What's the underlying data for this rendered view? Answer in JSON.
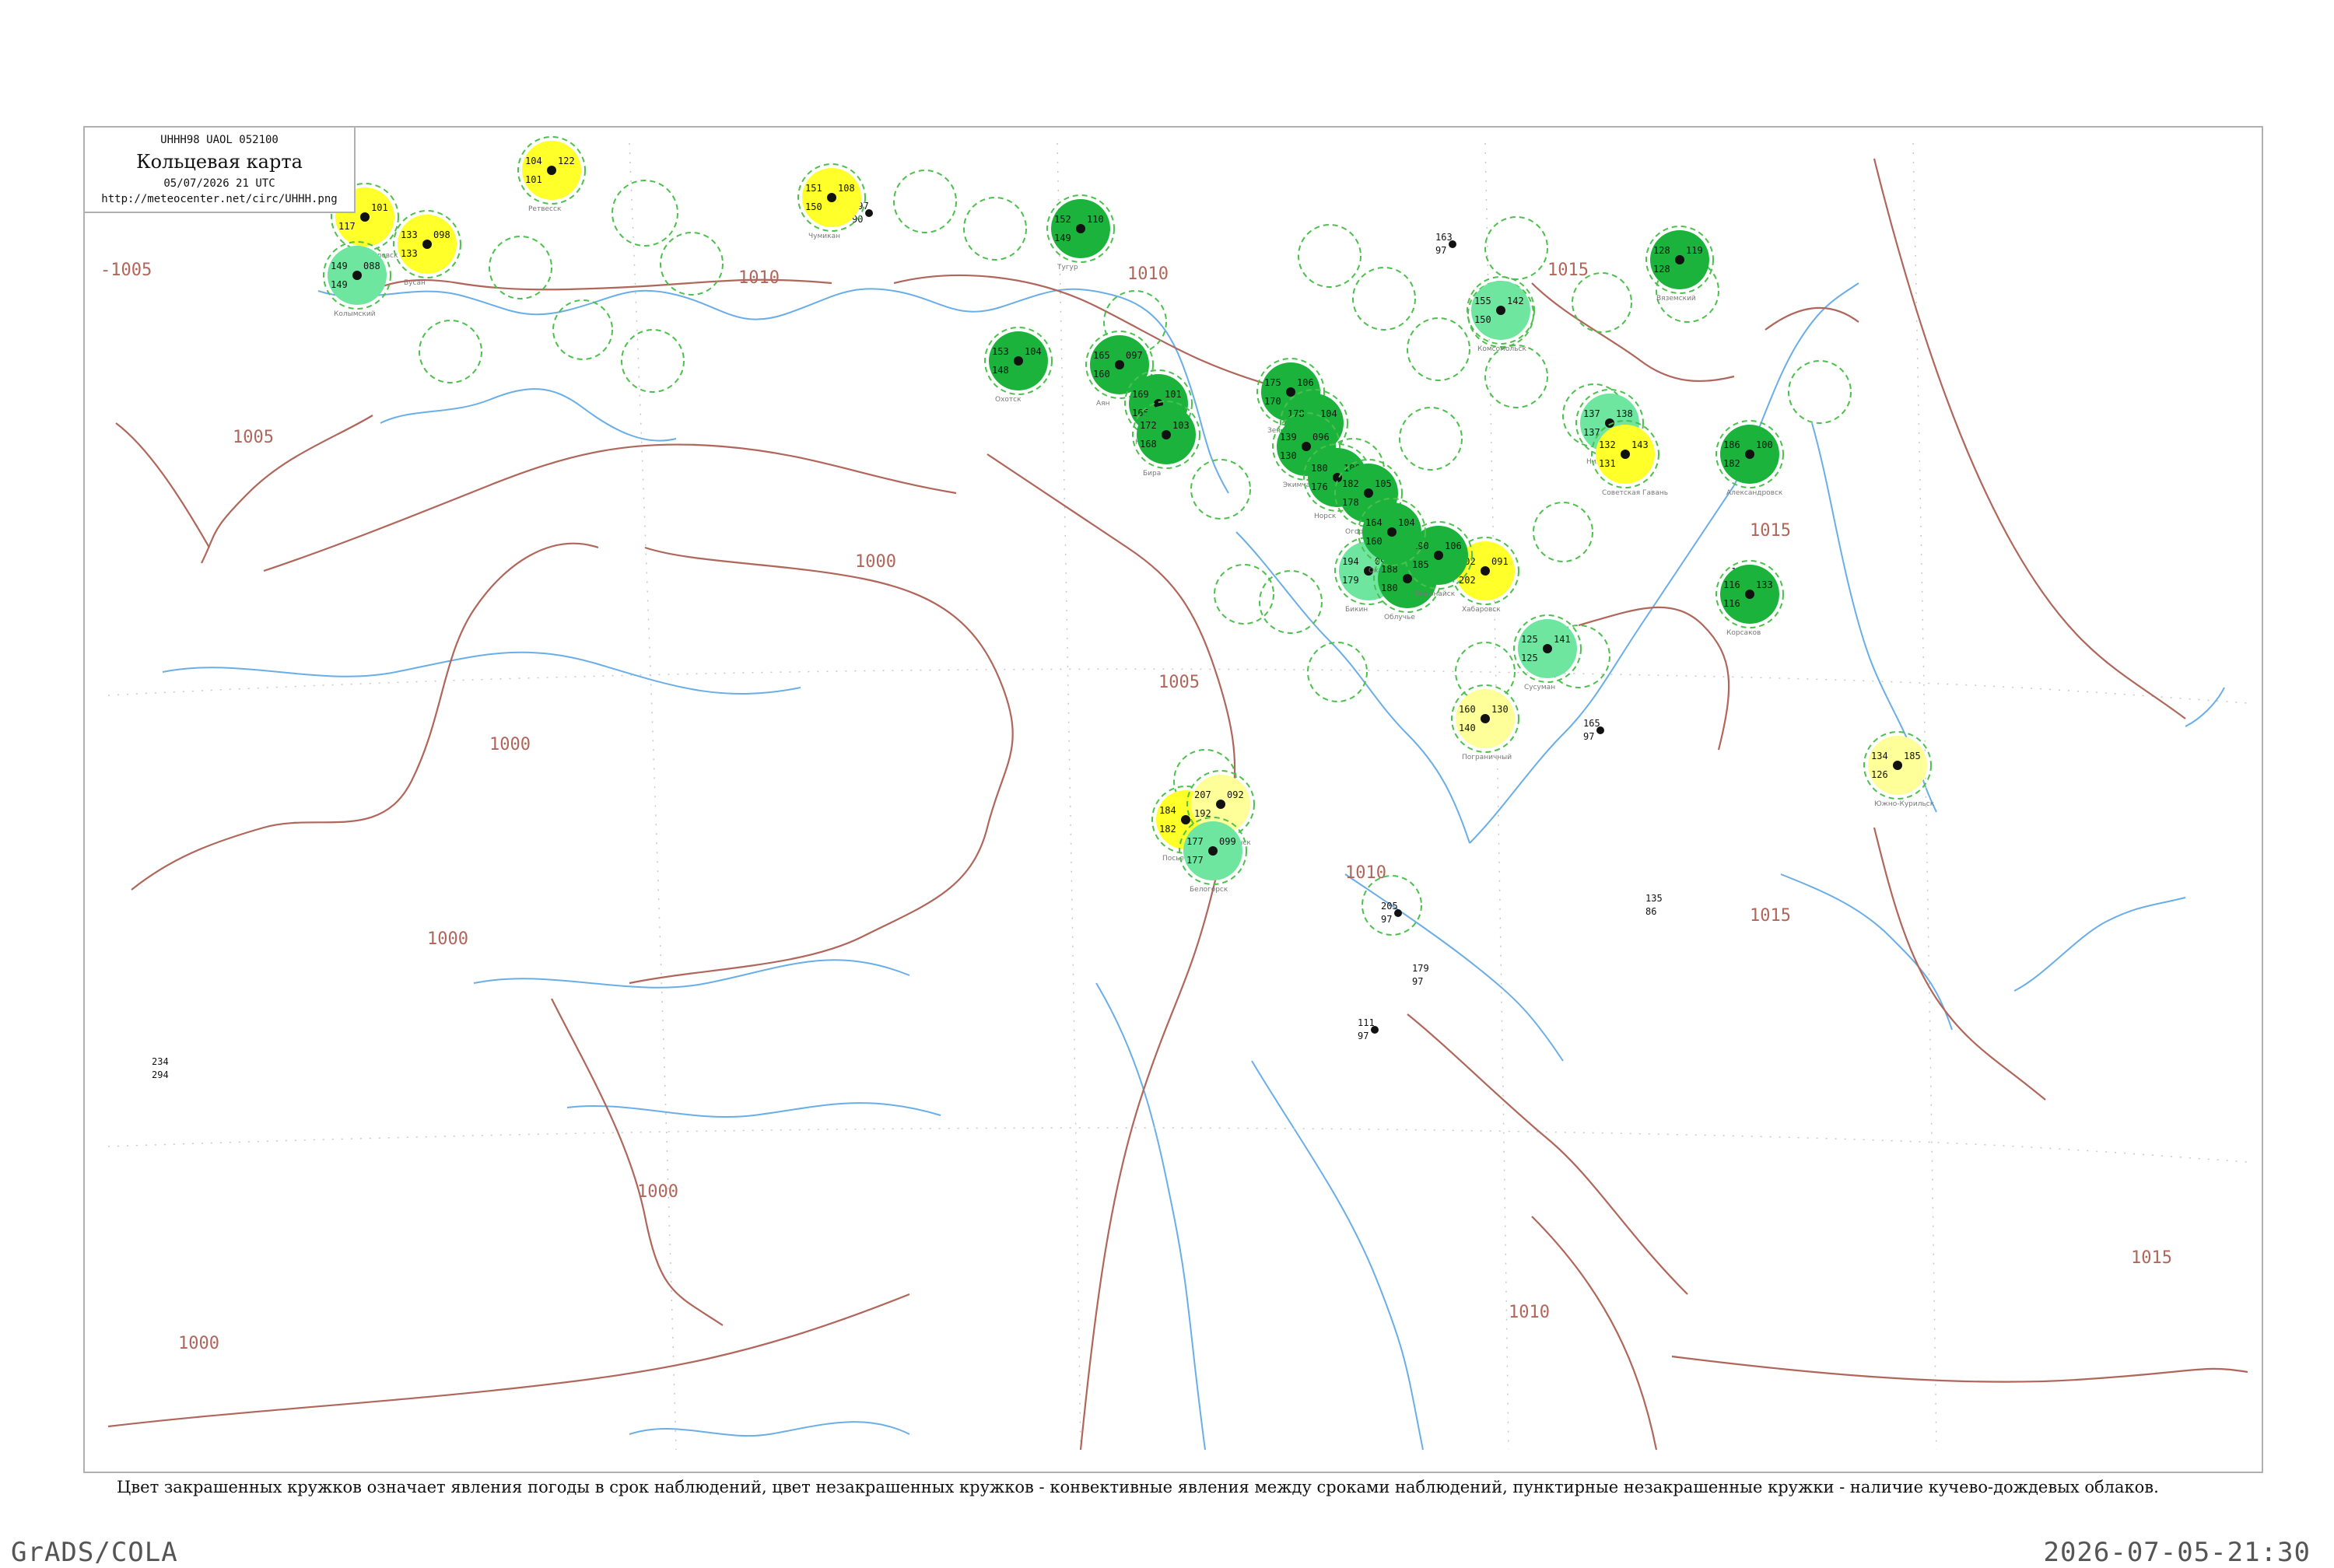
{
  "header": {
    "code_line": "UHHH98  UAOL  052100",
    "title": "Кольцевая карта",
    "datetime": "05/07/2026 21 UTC",
    "url": "http://meteocenter.net/circ/UHHH.png"
  },
  "caption": "Цвет закрашенных кружков означает явления погоды в срок наблюдений, цвет незакрашенных кружков - конвективные явления между сроками наблюдений, пунктирные незакрашенные кружки - наличие кучево-дождевых облаков.",
  "footer": {
    "left": "GrADS/COLA",
    "right": "2026-07-05-21:30"
  },
  "colors": {
    "isobar": "#b0665a",
    "coast": "#6aaee8",
    "green_dark": "#1cb33c",
    "green_light": "#6ee6a0",
    "yellow": "#ffff2a",
    "yellow_pale": "#ffff9a",
    "dashed_circle": "#4cc04c"
  },
  "isobars": [
    {
      "label": "1010"
    },
    {
      "label": "-1005"
    },
    {
      "label": "1005"
    },
    {
      "label": "1010"
    },
    {
      "label": "1015"
    },
    {
      "label": "1000"
    },
    {
      "label": "1000"
    },
    {
      "label": "1005"
    },
    {
      "label": "1015"
    },
    {
      "label": "1010"
    },
    {
      "label": "1000"
    },
    {
      "label": "1000"
    },
    {
      "label": "1015"
    },
    {
      "label": "1010"
    },
    {
      "label": "1000"
    }
  ],
  "stations": [
    {
      "t": "117",
      "p": "101",
      "d": "117",
      "fill": "yellow",
      "name": "Петропавловск"
    },
    {
      "t": "133",
      "p": "098",
      "d": "133",
      "fill": "yellow",
      "name": "Бусан"
    },
    {
      "t": "104",
      "p": "122",
      "d": "101",
      "fill": "yellow",
      "name": "Ретвесск"
    },
    {
      "t": "149",
      "p": "088",
      "d": "149",
      "fill": "green_light",
      "name": "Колымский"
    },
    {
      "t": "151",
      "p": "108",
      "d": "150",
      "fill": "yellow",
      "name": "Чумикан"
    },
    {
      "t": "152",
      "p": "110",
      "d": "149",
      "fill": "green_dark",
      "name": "Тугур"
    },
    {
      "t": "153",
      "p": "104",
      "d": "148",
      "fill": "green_dark",
      "name": "Охотск"
    },
    {
      "t": "165",
      "p": "097",
      "d": "160",
      "fill": "green_dark",
      "name": "Аян"
    },
    {
      "t": "169",
      "p": "101",
      "d": "165",
      "fill": "green_dark",
      "name": "Нелькан"
    },
    {
      "t": "172",
      "p": "103",
      "d": "168",
      "fill": "green_dark",
      "name": "Бира"
    },
    {
      "t": "175",
      "p": "106",
      "d": "170",
      "fill": "green_dark",
      "name": "Зея"
    },
    {
      "t": "178",
      "p": "104",
      "d": "172",
      "fill": "green_dark",
      "name": "Бомнак"
    },
    {
      "t": "139",
      "p": "096",
      "d": "130",
      "fill": "green_dark",
      "name": "Экимчан"
    },
    {
      "t": "180",
      "p": "100",
      "d": "176",
      "fill": "green_dark",
      "name": "Норск"
    },
    {
      "t": "182",
      "p": "105",
      "d": "178",
      "fill": "green_dark",
      "name": "Огорон"
    },
    {
      "t": "155",
      "p": "142",
      "d": "150",
      "fill": "green_light",
      "name": "Комсомольск"
    },
    {
      "t": "137",
      "p": "138",
      "d": "137",
      "fill": "green_light",
      "name": "Николаевск"
    },
    {
      "t": "132",
      "p": "143",
      "d": "131",
      "fill": "yellow",
      "name": "Советская Гавань"
    },
    {
      "t": "202",
      "p": "091",
      "d": "202",
      "fill": "yellow",
      "name": "Хабаровск"
    },
    {
      "t": "194",
      "p": "095",
      "d": "179",
      "fill": "green_light",
      "name": "Бикин"
    },
    {
      "t": "188",
      "p": "092",
      "d": "180",
      "fill": "green_dark",
      "name": "Облучье"
    },
    {
      "t": "125",
      "p": "141",
      "d": "125",
      "fill": "green_light",
      "name": "Сусуман"
    },
    {
      "t": "160",
      "p": "130",
      "d": "140",
      "fill": "yellow_pale",
      "name": "Пограничный"
    },
    {
      "t": "128",
      "p": "119",
      "d": "128",
      "fill": "green_dark",
      "name": "Вяземский"
    },
    {
      "t": "134",
      "p": "185",
      "d": "126",
      "fill": "yellow_pale",
      "name": "Южно-Курильск"
    },
    {
      "t": "184",
      "p": "093",
      "d": "182",
      "fill": "yellow",
      "name": "Посьет"
    },
    {
      "t": "207",
      "p": "092",
      "d": "192",
      "fill": "yellow_pale",
      "name": "Благовещенск"
    },
    {
      "t": "177",
      "p": "099",
      "d": "177",
      "fill": "green_light",
      "name": "Белогорск"
    },
    {
      "t": "186",
      "p": "100",
      "d": "182",
      "fill": "green_dark",
      "name": "Александровск"
    },
    {
      "t": "190",
      "p": "106",
      "d": "185",
      "fill": "green_dark",
      "name": "Поронайск"
    },
    {
      "t": "164",
      "p": "104",
      "d": "160",
      "fill": "green_dark",
      "name": "Оха"
    },
    {
      "t": "116",
      "p": "133",
      "d": "116",
      "fill": "green_dark",
      "name": "Корсаков"
    }
  ]
}
